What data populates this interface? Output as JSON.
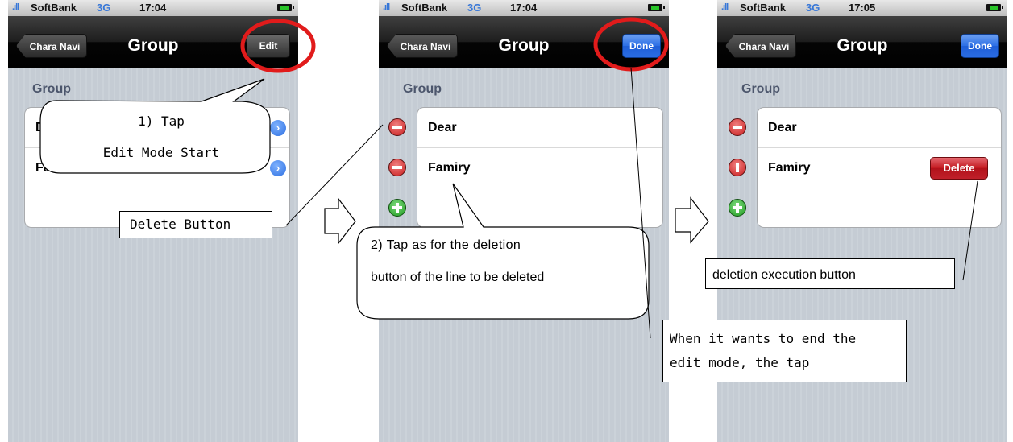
{
  "status_bar": {
    "signal": ".ıll",
    "carrier": "SoftBank",
    "network": "3G",
    "times": [
      "17:04",
      "17:04",
      "17:05"
    ]
  },
  "nav": {
    "back_label": "Chara Navi",
    "title": "Group",
    "edit_label": "Edit",
    "done_label": "Done"
  },
  "section_header": "Group",
  "rows": {
    "panel1": [
      "De",
      "Fam"
    ],
    "panel2": [
      "Dear",
      "Famiry"
    ],
    "panel3": [
      "Dear",
      "Famiry"
    ]
  },
  "delete_label": "Delete",
  "annotations": {
    "step1_line1": "1) Tap",
    "step1_line2": "Edit Mode Start",
    "delete_button": "Delete Button",
    "step2_line1": "2) Tap as for the deletion",
    "step2_line2": "button of the line to be deleted",
    "end_edit_line1": "When it wants to end the",
    "end_edit_line2": "edit mode, the tap",
    "deletion_execution": "deletion execution button"
  },
  "colors": {
    "highlight_circle": "#e11b1b",
    "table_background": "#c5ccd4",
    "done_blue": "#2c6fe6",
    "delete_red": "#c2181f"
  }
}
